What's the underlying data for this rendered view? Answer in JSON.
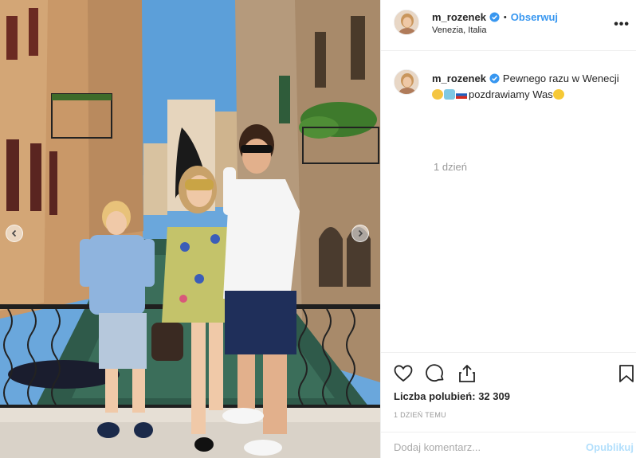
{
  "post": {
    "username": "m_rozenek",
    "follow_label": "Obserwuj",
    "separator": "•",
    "location": "Venezia, Italia",
    "more_label": "•••"
  },
  "caption": {
    "username": "m_rozenek",
    "text_part1": "Pewnego razu w Wenecji",
    "text_part2": "pozdrawiamy Was",
    "emoji": [
      "person-blonde-emoji",
      "mask-emoji",
      "russia-flag-emoji",
      "astonished-face-emoji"
    ],
    "time": "1 dzień"
  },
  "actions": {
    "likes_label": "Liczba polubień:",
    "likes_count": "32 309",
    "time_ago": "1 DZIEŃ TEMU",
    "comment_placeholder": "Dodaj komentarz...",
    "post_label": "Opublikuj"
  },
  "colors": {
    "link_blue": "#3897f0",
    "verified_blue": "#3897f0",
    "muted_gray": "#999999",
    "border": "#efefef",
    "post_disabled": "#b2dffc"
  },
  "photo": {
    "description_icon": "photo-venice-family"
  }
}
